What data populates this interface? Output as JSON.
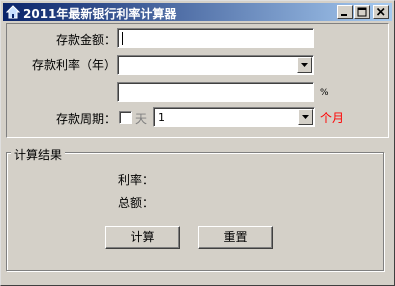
{
  "window": {
    "title": "2011年最新银行利率计算器",
    "controls": {
      "minimize": "_",
      "maximize": "□",
      "close": "×"
    }
  },
  "form": {
    "amount_label": "存款金额：",
    "amount_value": "",
    "rate_label": "存款利率（年）",
    "rate_selected": "",
    "rate_extra_value": "",
    "percent_sign": "%",
    "period_label": "存款周期：",
    "day_label": "天",
    "day_checked": false,
    "period_selected": "1",
    "month_label": "个月"
  },
  "result": {
    "group_title": "计算结果",
    "rate_label": "利率：",
    "total_label": "总额："
  },
  "buttons": {
    "calculate": "计算",
    "reset": "重置"
  },
  "colors": {
    "window_bg": "#d4d0c8",
    "title_start": "#0a246a",
    "title_end": "#a6caf0",
    "month_text": "#ff0000"
  },
  "icons": {
    "app": "house-icon",
    "dropdown": "chevron-down-icon"
  }
}
